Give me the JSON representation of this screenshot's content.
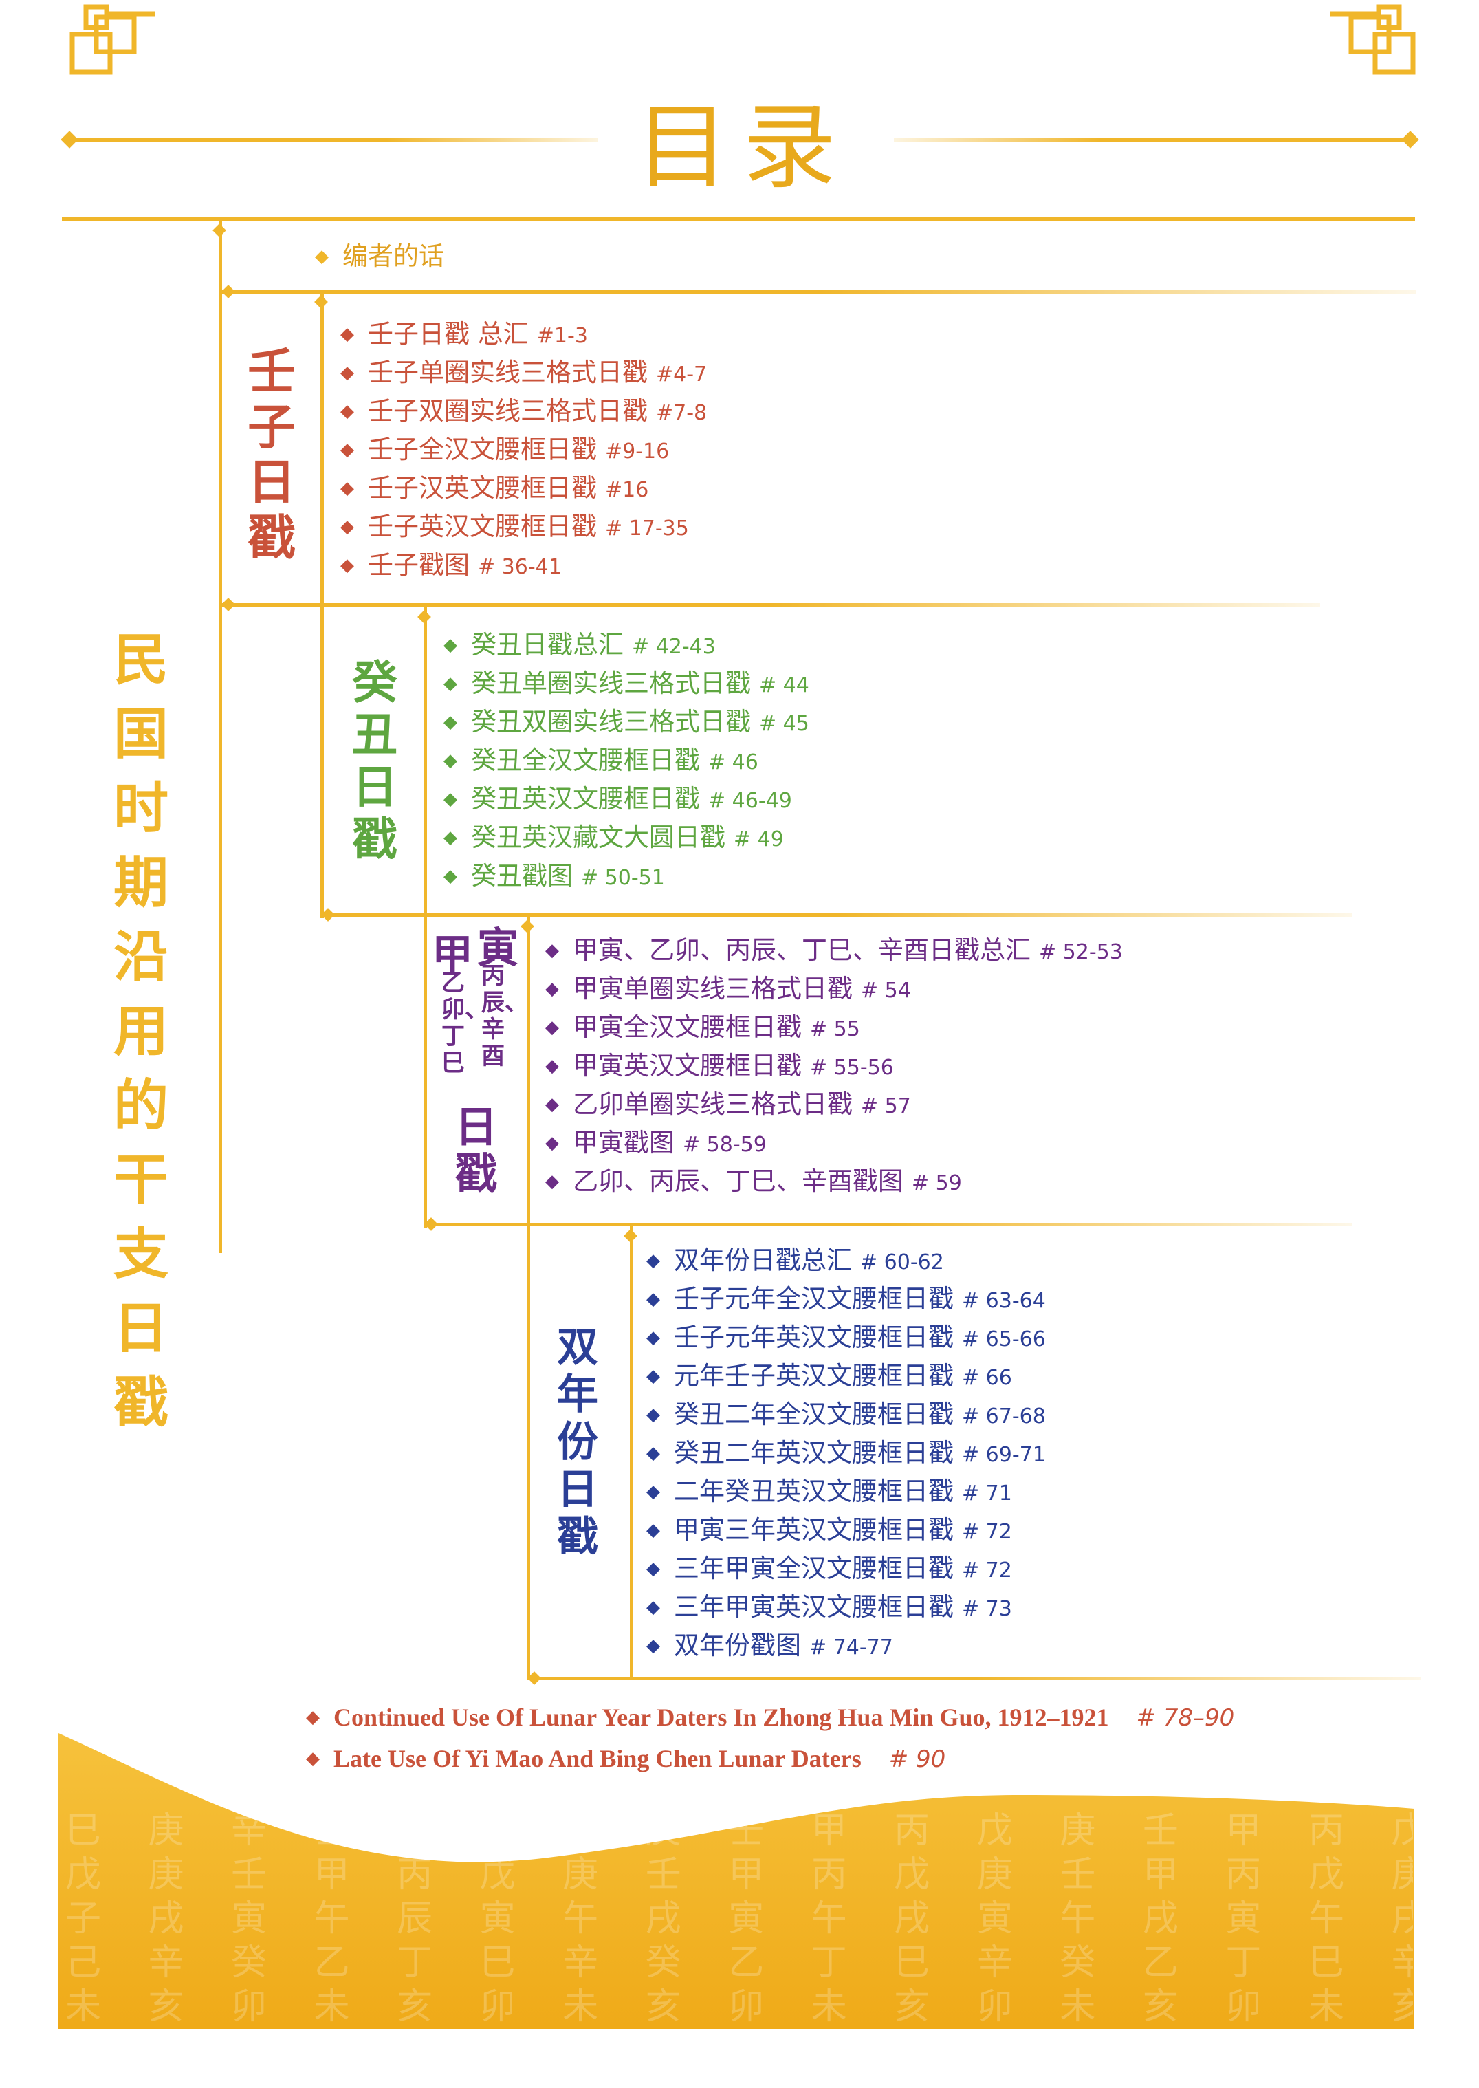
{
  "title": "目录",
  "main_vertical": "民国时期沿用的干支日戳",
  "editor_note": "编者的话",
  "sections": {
    "renzi": {
      "label": "壬子日戳",
      "items": [
        {
          "text": "壬子日戳 总汇",
          "num": "#1-3"
        },
        {
          "text": "壬子单圈实线三格式日戳",
          "num": "#4-7"
        },
        {
          "text": "壬子双圈实线三格式日戳",
          "num": "#7-8"
        },
        {
          "text": "壬子全汉文腰框日戳",
          "num": "#9-16"
        },
        {
          "text": "壬子汉英文腰框日戳",
          "num": "#16"
        },
        {
          "text": "壬子英汉文腰框日戳",
          "num": "# 17-35"
        },
        {
          "text": "壬子戳图",
          "num": "# 36-41"
        }
      ]
    },
    "guichou": {
      "label": "癸丑日戳",
      "items": [
        {
          "text": "癸丑日戳总汇",
          "num": "# 42-43"
        },
        {
          "text": "癸丑单圈实线三格式日戳",
          "num": "# 44"
        },
        {
          "text": "癸丑双圈实线三格式日戳",
          "num": "# 45"
        },
        {
          "text": "癸丑全汉文腰框日戳",
          "num": "# 46"
        },
        {
          "text": "癸丑英汉文腰框日戳",
          "num": "# 46-49"
        },
        {
          "text": "癸丑英汉藏文大圆日戳",
          "num": "# 49"
        },
        {
          "text": "癸丑戳图",
          "num": "# 50-51"
        }
      ]
    },
    "jiayin": {
      "label_big1": "甲",
      "label_big2": "寅",
      "label_small_a": "乙卯、丁巳",
      "label_small_b": "丙辰、辛酉",
      "label_rijuan": "日戳",
      "items": [
        {
          "text": "甲寅、乙卯、丙辰、丁巳、辛酉日戳总汇",
          "num": "# 52-53"
        },
        {
          "text": "甲寅单圈实线三格式日戳",
          "num": "# 54"
        },
        {
          "text": "甲寅全汉文腰框日戳",
          "num": "# 55"
        },
        {
          "text": "甲寅英汉文腰框日戳",
          "num": "# 55-56"
        },
        {
          "text": "乙卯单圈实线三格式日戳",
          "num": "# 57"
        },
        {
          "text": "甲寅戳图",
          "num": "# 58-59"
        },
        {
          "text": "乙卯、丙辰、丁巳、辛酉戳图",
          "num": "# 59"
        }
      ]
    },
    "shuangnian": {
      "label": "双年份日戳",
      "items": [
        {
          "text": "双年份日戳总汇",
          "num": "# 60-62"
        },
        {
          "text": "壬子元年全汉文腰框日戳",
          "num": "# 63-64"
        },
        {
          "text": "壬子元年英汉文腰框日戳",
          "num": "# 65-66"
        },
        {
          "text": "元年壬子英汉文腰框日戳",
          "num": "# 66"
        },
        {
          "text": "癸丑二年全汉文腰框日戳",
          "num": "# 67-68"
        },
        {
          "text": "癸丑二年英汉文腰框日戳",
          "num": "# 69-71"
        },
        {
          "text": "二年癸丑英汉文腰框日戳",
          "num": "# 71"
        },
        {
          "text": "甲寅三年英汉文腰框日戳",
          "num": "# 72"
        },
        {
          "text": "三年甲寅全汉文腰框日戳",
          "num": "# 72"
        },
        {
          "text": "三年甲寅英汉文腰框日戳",
          "num": "# 73"
        },
        {
          "text": "双年份戳图",
          "num": "# 74-77"
        }
      ]
    }
  },
  "english": [
    {
      "text": "Continued Use Of Lunar Year Daters In Zhong Hua Min Guo, 1912–1921",
      "num": "# 78–90"
    },
    {
      "text": "Late Use Of Yi Mao And Bing Chen Lunar Daters",
      "num": "# 90"
    }
  ],
  "bg_chars_row1": "巳 庚 辛 壬 甲 丙 戊 庚 壬 甲 丙 戊 庚 壬 甲 丙 戊 庚",
  "bg_chars_row2": "戊 庚 壬 甲 丙 戊 庚 壬 甲 丙 戊 庚 壬 甲 丙 戊 庚",
  "bg_chars_row3": "子 戌 寅 午 辰 寅 午 戌 寅 午 戌 寅 午 戌 寅 午 戌 寅",
  "bg_chars_row4": "己 辛 癸 乙 丁 巳 辛 癸 乙 丁 巳 辛 癸 乙 丁 巳 辛 癸",
  "bg_chars_row5": "未 亥 卯 未 亥 卯 未 亥 卯 未 亥 卯 未 亥 卯 未 亥 卯",
  "colors": {
    "gold": "#f0b62a",
    "red": "#c9523a",
    "green": "#5ea640",
    "purple": "#6c2d86",
    "blue": "#2b3f96"
  }
}
